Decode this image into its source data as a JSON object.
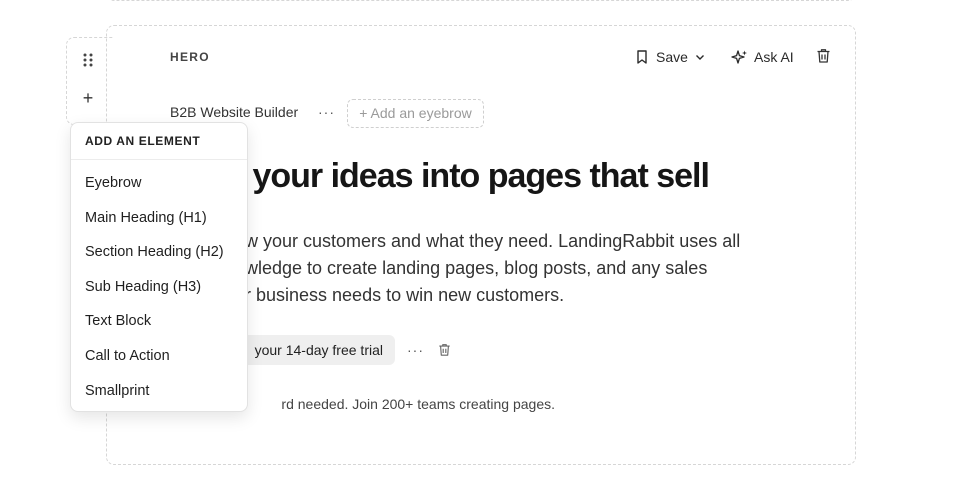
{
  "section": {
    "label": "HERO",
    "toolbar": {
      "save_label": "Save",
      "ask_ai_label": "Ask AI"
    }
  },
  "eyebrow": {
    "text": "B2B Website Builder",
    "more_label": "···",
    "add_label": "+ Add an eyebrow"
  },
  "content": {
    "heading_visible": "your ideas into pages that sell",
    "body_lines": [
      "w your customers and what they need. LandingRabbit uses all",
      "wledge to create landing pages, blog posts, and any sales",
      "r business needs to win new customers."
    ],
    "cta_label": "your 14-day free trial",
    "cta_more_label": "···",
    "smallprint": "rd needed. Join 200+ teams creating pages."
  },
  "add_element_menu": {
    "title": "ADD AN ELEMENT",
    "items": [
      "Eyebrow",
      "Main Heading (H1)",
      "Section Heading (H2)",
      "Sub Heading (H3)",
      "Text Block",
      "Call to Action",
      "Smallprint"
    ]
  },
  "left_controls": {
    "add_label": "+"
  },
  "colors": {
    "border_dashed": "#d6d6d6",
    "text_primary": "#1f1f1f",
    "cta_bg": "#efefef"
  }
}
